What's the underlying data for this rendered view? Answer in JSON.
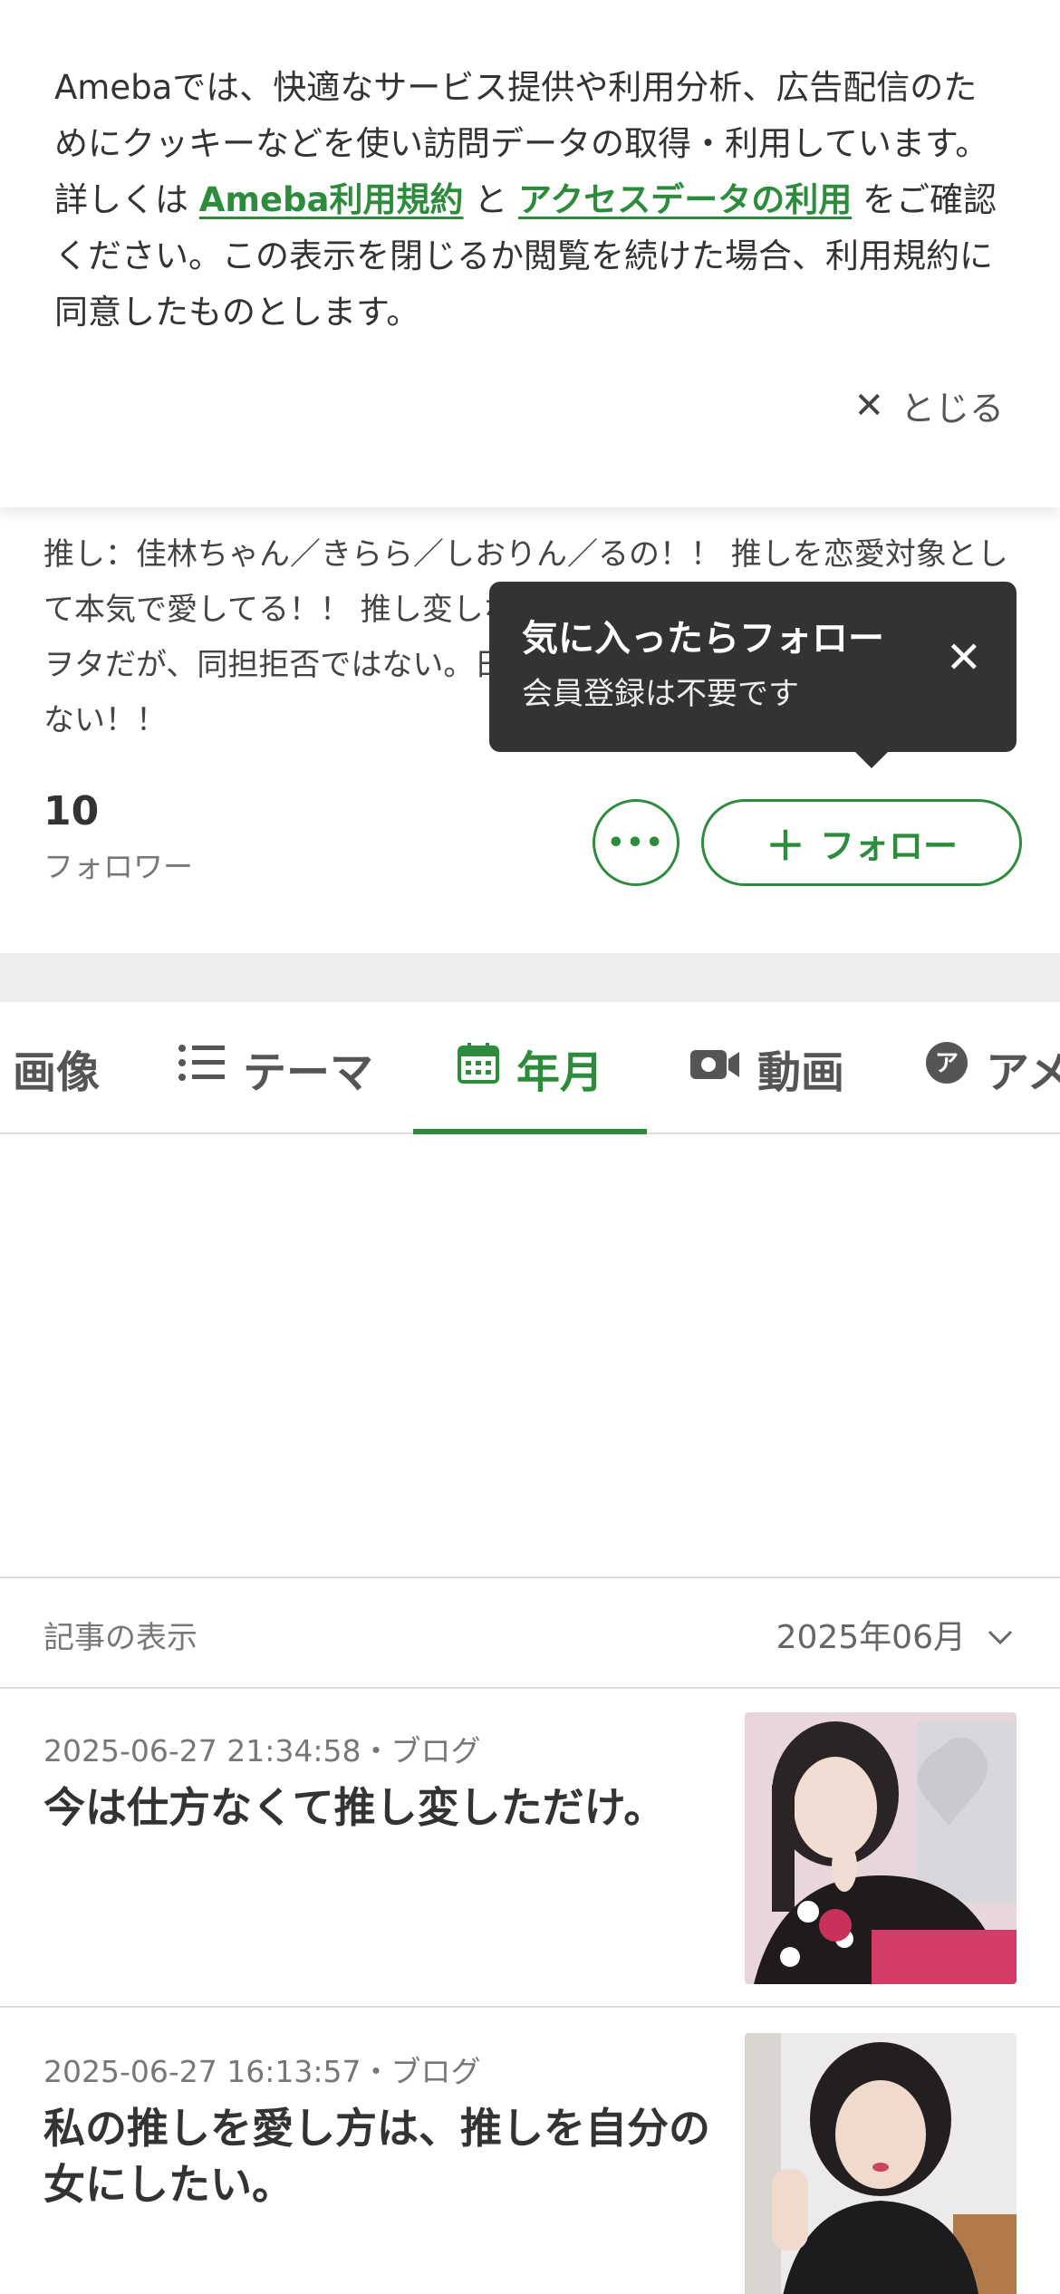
{
  "cookie_banner": {
    "text_before": "Amebaでは、快適なサービス提供や利用分析、広告配信のためにクッキーなどを使い訪問データの取得・利用しています。詳しくは ",
    "link_terms": "Ameba利用規約",
    "text_and": " と ",
    "link_access": "アクセスデータの利用",
    "text_after": " をご確認ください。この表示を閉じるか閲覧を続けた場合、利用規約に同意したものとします。",
    "close_label": "とじる"
  },
  "profile": {
    "description": "推し：佳林ちゃん／きらら／しおりん／るの！！ 推しを恋愛対象として本気で愛してる！！ 推し変しない推し方をしたいのです！！ ガチ恋ヲタだが、同担拒否ではない。日本人ではなくて、日本語は上手ではない！！",
    "follower_count": "10",
    "follower_label": "フォロワー",
    "follow_label": "フォロー"
  },
  "tooltip": {
    "title": "気に入ったらフォロー",
    "subtitle": "会員登録は不要です"
  },
  "tabs": [
    {
      "label": "画像"
    },
    {
      "label": "テーマ"
    },
    {
      "label": "年月"
    },
    {
      "label": "動画"
    },
    {
      "label": "アメ"
    }
  ],
  "active_tab": "年月",
  "article_display": {
    "label": "記事の表示",
    "selected_month": "2025年06月"
  },
  "articles": [
    {
      "meta": "2025-06-27 21:34:58・ブログ",
      "title": "今は仕方なくて推し変しただけ。"
    },
    {
      "meta": "2025-06-27 16:13:57・ブログ",
      "title": "私の推しを愛し方は、推しを自分の女にしたい。"
    }
  ],
  "colors": {
    "accent": "#2d8c3c",
    "tooltip_bg": "#333333",
    "divider": "#eeeeee"
  }
}
